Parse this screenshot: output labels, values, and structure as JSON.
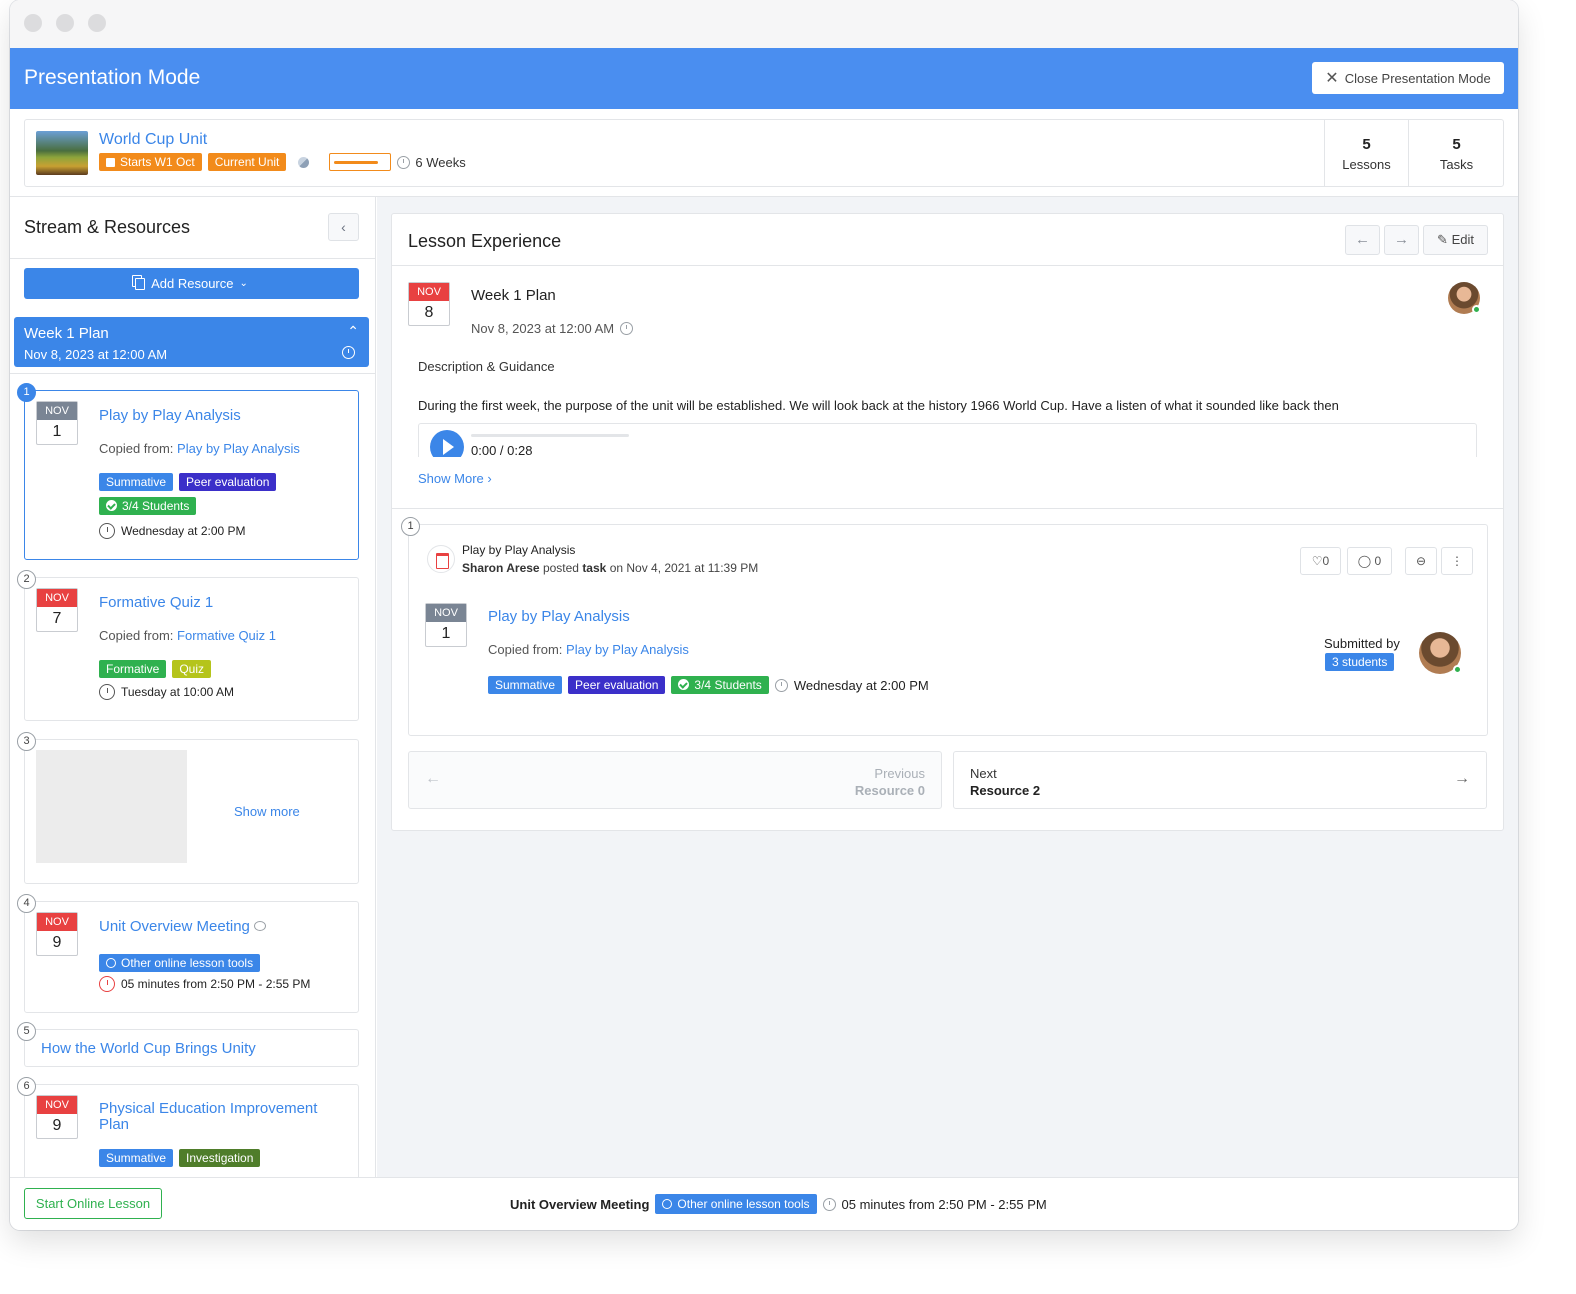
{
  "window": {
    "title": "Presentation Mode",
    "close_label": "Close Presentation Mode"
  },
  "unit": {
    "name": "World Cup Unit",
    "starts_tag": "Starts W1 Oct",
    "current_tag": "Current Unit",
    "progress": 0.85,
    "duration": "6 Weeks",
    "lessons_count": "5",
    "lessons_label": "Lessons",
    "tasks_count": "5",
    "tasks_label": "Tasks"
  },
  "sidebar": {
    "title": "Stream & Resources",
    "add_resource_label": "Add Resource",
    "week": {
      "title": "Week 1 Plan",
      "date": "Nov 8, 2023 at 12:00 AM"
    },
    "items": [
      {
        "num": "1",
        "month": "NOV",
        "day": "1",
        "title": "Play by Play Analysis",
        "copied_prefix": "Copied from:",
        "copied_link": "Play by Play Analysis",
        "tags": [
          "Summative",
          "Peer evaluation",
          "3/4 Students"
        ],
        "time": "Wednesday at 2:00 PM"
      },
      {
        "num": "2",
        "month": "NOV",
        "day": "7",
        "title": "Formative Quiz 1",
        "copied_prefix": "Copied from:",
        "copied_link": "Formative Quiz 1",
        "tags": [
          "Formative",
          "Quiz"
        ],
        "time": "Tuesday at 10:00 AM"
      },
      {
        "num": "3",
        "show_more": "Show more"
      },
      {
        "num": "4",
        "month": "NOV",
        "day": "9",
        "title": "Unit Overview Meeting",
        "tags": [
          "Other online lesson tools"
        ],
        "time": "05 minutes from 2:50 PM - 2:55 PM"
      },
      {
        "num": "5",
        "title": "How the World Cup Brings Unity"
      },
      {
        "num": "6",
        "month": "NOV",
        "day": "9",
        "title": "Physical Education Improvement Plan",
        "tags": [
          "Summative",
          "Investigation"
        ]
      }
    ]
  },
  "lesson": {
    "title": "Lesson Experience",
    "edit_label": "Edit",
    "plan": {
      "month": "NOV",
      "day": "8",
      "title": "Week 1 Plan",
      "date": "Nov 8, 2023 at 12:00 AM"
    },
    "guidance_label": "Description & Guidance",
    "description": "During the first week, the purpose of the unit will be established. We will look back at the history 1966 World Cup. Have a listen of what it sounded like back then",
    "audio_time": "0:00 / 0:28",
    "show_more": "Show More",
    "post": {
      "num": "1",
      "name": "Play by Play Analysis",
      "author": "Sharon Arese",
      "posted": "posted",
      "kind": "task",
      "date_text": "on Nov 4, 2021 at 11:39 PM",
      "likes": "0",
      "comments": "0",
      "month": "NOV",
      "day": "1",
      "title": "Play by Play Analysis",
      "copied_prefix": "Copied from:",
      "copied_link": "Play by Play Analysis",
      "tags": [
        "Summative",
        "Peer evaluation",
        "3/4 Students"
      ],
      "time": "Wednesday at 2:00 PM",
      "submitted_label": "Submitted by",
      "submitted_count": "3 students"
    },
    "prev": {
      "label": "Previous",
      "name": "Resource 0"
    },
    "next": {
      "label": "Next",
      "name": "Resource 2"
    }
  },
  "bottom": {
    "start_label": "Start Online Lesson",
    "meeting_title": "Unit Overview Meeting",
    "meeting_tag": "Other online lesson tools",
    "meeting_time": "05 minutes from 2:50 PM - 2:55 PM"
  },
  "colors": {
    "brand_blue": "#4a8ef0",
    "accent_blue": "#3b86e8",
    "orange": "#f28b1b",
    "navy": "#3b2fc9",
    "green": "#2fb14f",
    "red": "#e84141"
  }
}
